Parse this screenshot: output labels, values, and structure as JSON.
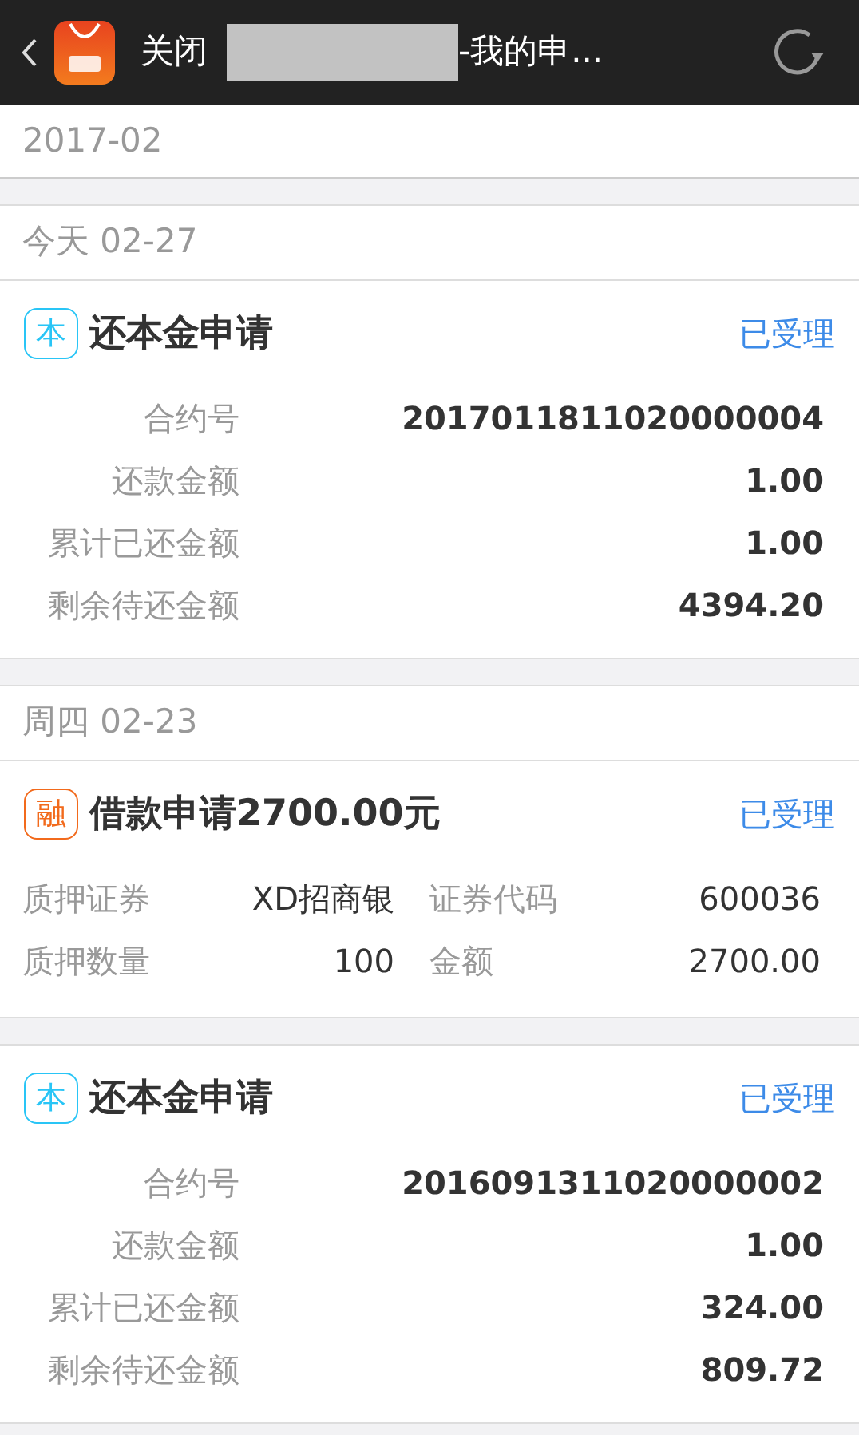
{
  "header": {
    "close": "关闭",
    "title": "-我的申..."
  },
  "month": "2017-02",
  "days": [
    {
      "date": "今天 02-27",
      "cards": [
        {
          "kind": "repay",
          "badge": "本",
          "color": "#29c5f6",
          "title": "还本金申请",
          "status": "已受理",
          "rows": [
            {
              "label": "合约号",
              "value": "2017011811020000004"
            },
            {
              "label": "还款金额",
              "value": "1.00"
            },
            {
              "label": "累计已还金额",
              "value": "1.00"
            },
            {
              "label": "剩余待还金额",
              "value": "4394.20"
            }
          ]
        }
      ]
    },
    {
      "date": "周四 02-23",
      "cards": [
        {
          "kind": "loan",
          "badge": "融",
          "color": "#f26a1c",
          "title": "借款申请2700.00元",
          "status": "已受理",
          "rows": [
            {
              "label": "质押证券",
              "value": "XD招商银"
            },
            {
              "label": "证券代码",
              "value": "600036"
            },
            {
              "label": "质押数量",
              "value": "100"
            },
            {
              "label": "金额",
              "value": "2700.00"
            }
          ]
        },
        {
          "kind": "repay",
          "badge": "本",
          "color": "#29c5f6",
          "title": "还本金申请",
          "status": "已受理",
          "rows": [
            {
              "label": "合约号",
              "value": "2016091311020000002"
            },
            {
              "label": "还款金额",
              "value": "1.00"
            },
            {
              "label": "累计已还金额",
              "value": "324.00"
            },
            {
              "label": "剩余待还金额",
              "value": "809.72"
            }
          ]
        }
      ]
    }
  ]
}
